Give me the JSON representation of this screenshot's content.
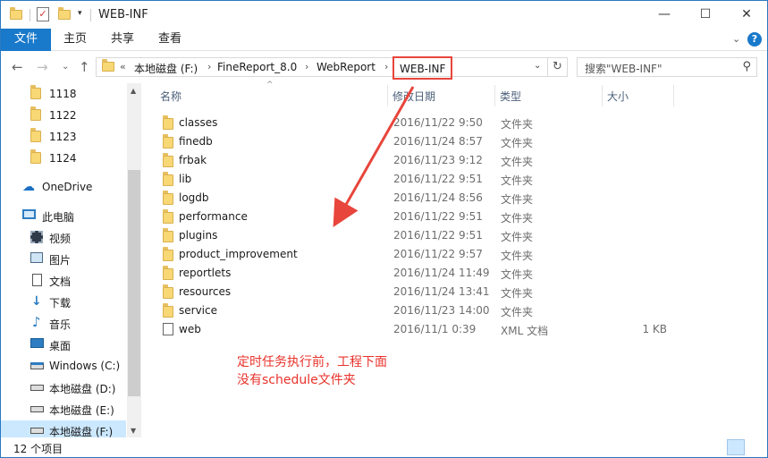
{
  "title": "WEB-INF",
  "window_controls": {
    "minimize": "—",
    "maximize": "☐",
    "close": "✕"
  },
  "ribbon": {
    "tabs": [
      {
        "label": "文件",
        "active": true
      },
      {
        "label": "主页"
      },
      {
        "label": "共享"
      },
      {
        "label": "查看"
      }
    ],
    "expand_icon": "⌄",
    "help_icon": "?"
  },
  "address": {
    "overflow": "«",
    "crumbs": [
      "本地磁盘 (F:)",
      "FineReport_8.0",
      "WebReport"
    ],
    "current": "WEB-INF",
    "search_placeholder": "搜索\"WEB-INF\""
  },
  "nav_buttons": {
    "back": "←",
    "forward": "→",
    "recent": "⌄",
    "up": "↑"
  },
  "navpane": {
    "items": [
      {
        "label": "1118",
        "icon": "folder-icon"
      },
      {
        "label": "1122",
        "icon": "folder-icon"
      },
      {
        "label": "1123",
        "icon": "folder-icon"
      },
      {
        "label": "1124",
        "icon": "folder-icon"
      },
      {
        "label": "OneDrive",
        "icon": "cloud-icon"
      },
      {
        "label": "此电脑",
        "icon": "computer-icon"
      },
      {
        "label": "视频",
        "icon": "video-icon"
      },
      {
        "label": "图片",
        "icon": "picture-icon"
      },
      {
        "label": "文档",
        "icon": "document-icon"
      },
      {
        "label": "下载",
        "icon": "download-icon"
      },
      {
        "label": "音乐",
        "icon": "music-icon"
      },
      {
        "label": "桌面",
        "icon": "desktop-icon"
      },
      {
        "label": "Windows (C:)",
        "icon": "windows-drive-icon"
      },
      {
        "label": "本地磁盘 (D:)",
        "icon": "drive-icon"
      },
      {
        "label": "本地磁盘 (E:)",
        "icon": "drive-icon"
      },
      {
        "label": "本地磁盘 (F:)",
        "icon": "drive-icon",
        "selected": true
      }
    ]
  },
  "columns": {
    "name": "名称",
    "date": "修改日期",
    "type": "类型",
    "size": "大小"
  },
  "files": [
    {
      "name": "classes",
      "date": "2016/11/22 9:50",
      "type": "文件夹",
      "size": "",
      "icon": "folder-icon"
    },
    {
      "name": "finedb",
      "date": "2016/11/24 8:57",
      "type": "文件夹",
      "size": "",
      "icon": "folder-icon"
    },
    {
      "name": "frbak",
      "date": "2016/11/23 9:12",
      "type": "文件夹",
      "size": "",
      "icon": "folder-icon"
    },
    {
      "name": "lib",
      "date": "2016/11/22 9:51",
      "type": "文件夹",
      "size": "",
      "icon": "folder-icon"
    },
    {
      "name": "logdb",
      "date": "2016/11/24 8:56",
      "type": "文件夹",
      "size": "",
      "icon": "folder-icon"
    },
    {
      "name": "performance",
      "date": "2016/11/22 9:51",
      "type": "文件夹",
      "size": "",
      "icon": "folder-icon"
    },
    {
      "name": "plugins",
      "date": "2016/11/22 9:51",
      "type": "文件夹",
      "size": "",
      "icon": "folder-icon"
    },
    {
      "name": "product_improvement",
      "date": "2016/11/22 9:57",
      "type": "文件夹",
      "size": "",
      "icon": "folder-icon"
    },
    {
      "name": "reportlets",
      "date": "2016/11/24 11:49",
      "type": "文件夹",
      "size": "",
      "icon": "folder-icon"
    },
    {
      "name": "resources",
      "date": "2016/11/24 13:41",
      "type": "文件夹",
      "size": "",
      "icon": "folder-icon"
    },
    {
      "name": "service",
      "date": "2016/11/23 14:00",
      "type": "文件夹",
      "size": "",
      "icon": "folder-icon"
    },
    {
      "name": "web",
      "date": "2016/11/1 0:39",
      "type": "XML 文档",
      "size": "1 KB",
      "icon": "xml-file-icon"
    }
  ],
  "annotation": {
    "line1": "定时任务执行前，工程下面",
    "line2": "没有schedule文件夹",
    "color": "#e8322b"
  },
  "status": {
    "item_count": "12 个项目"
  }
}
